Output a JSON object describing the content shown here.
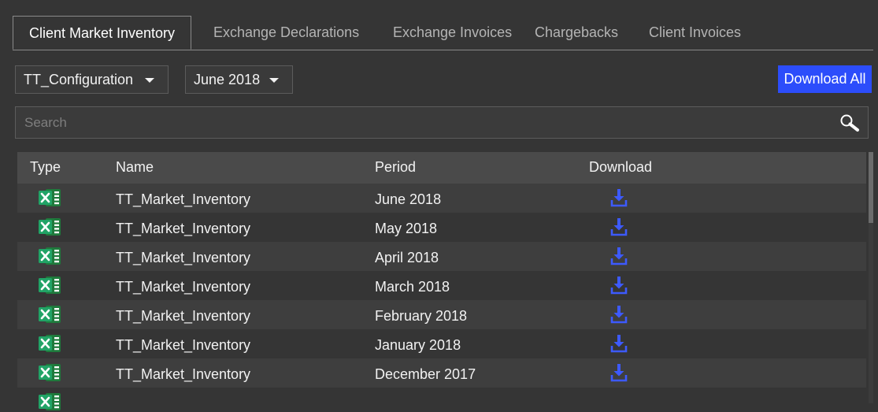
{
  "tabs": [
    {
      "label": "Client Market Inventory",
      "active": true
    },
    {
      "label": "Exchange Declarations",
      "active": false
    },
    {
      "label": "Exchange Invoices",
      "active": false
    },
    {
      "label": "Chargebacks",
      "active": false
    },
    {
      "label": "Client Invoices",
      "active": false
    }
  ],
  "filters": {
    "configuration": "TT_Configuration",
    "period": "June 2018"
  },
  "download_all_label": "Download All",
  "search": {
    "placeholder": "Search",
    "value": ""
  },
  "table": {
    "columns": [
      "Type",
      "Name",
      "Period",
      "Download"
    ],
    "rows": [
      {
        "type": "excel-icon",
        "name": "TT_Market_Inventory",
        "period": "June 2018"
      },
      {
        "type": "excel-icon",
        "name": "TT_Market_Inventory",
        "period": "May 2018"
      },
      {
        "type": "excel-icon",
        "name": "TT_Market_Inventory",
        "period": "April 2018"
      },
      {
        "type": "excel-icon",
        "name": "TT_Market_Inventory",
        "period": "March 2018"
      },
      {
        "type": "excel-icon",
        "name": "TT_Market_Inventory",
        "period": "February 2018"
      },
      {
        "type": "excel-icon",
        "name": "TT_Market_Inventory",
        "period": "January 2018"
      },
      {
        "type": "excel-icon",
        "name": "TT_Market_Inventory",
        "period": "December 2017"
      },
      {
        "type": "excel-icon",
        "name": "",
        "period": ""
      }
    ]
  },
  "colors": {
    "background": "#353535",
    "accent": "#2c4dfb",
    "excel_green": "#1f7a3c",
    "download_icon": "#3d5afe"
  }
}
